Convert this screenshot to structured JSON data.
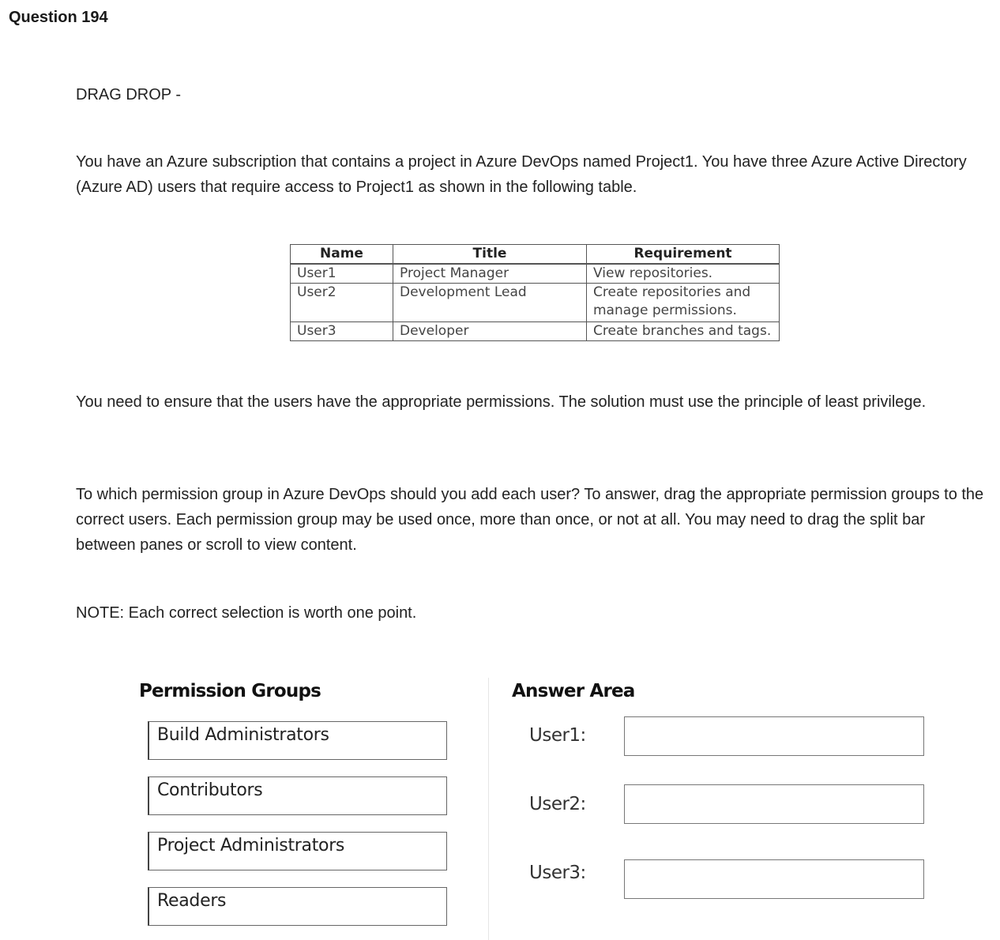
{
  "question": {
    "title": "Question 194",
    "type_label": "DRAG DROP -",
    "intro": "You have an Azure subscription that contains a project in Azure DevOps named Project1. You have three Azure Active Directory (Azure AD) users that require access to Project1 as shown in the following table.",
    "need": "You need to ensure that the users have the appropriate permissions. The solution must use the principle of least privilege.",
    "instructions": "To which permission group in Azure DevOps should you add each user? To answer, drag the appropriate permission groups to the correct users. Each permission group may be used once, more than once, or not at all. You may need to drag the split bar between panes or scroll to view content.",
    "note": "NOTE: Each correct selection is worth one point."
  },
  "user_table": {
    "headers": [
      "Name",
      "Title",
      "Requirement"
    ],
    "rows": [
      {
        "name": "User1",
        "title": "Project Manager",
        "requirement": "View repositories."
      },
      {
        "name": "User2",
        "title": "Development Lead",
        "requirement": "Create repositories and manage permissions."
      },
      {
        "name": "User3",
        "title": "Developer",
        "requirement": "Create branches and tags."
      }
    ]
  },
  "permission_groups": {
    "header": "Permission Groups",
    "items": [
      "Build Administrators",
      "Contributors",
      "Project Administrators",
      "Readers"
    ]
  },
  "answer_area": {
    "header": "Answer Area",
    "labels": [
      "User1:",
      "User2:",
      "User3:"
    ]
  }
}
